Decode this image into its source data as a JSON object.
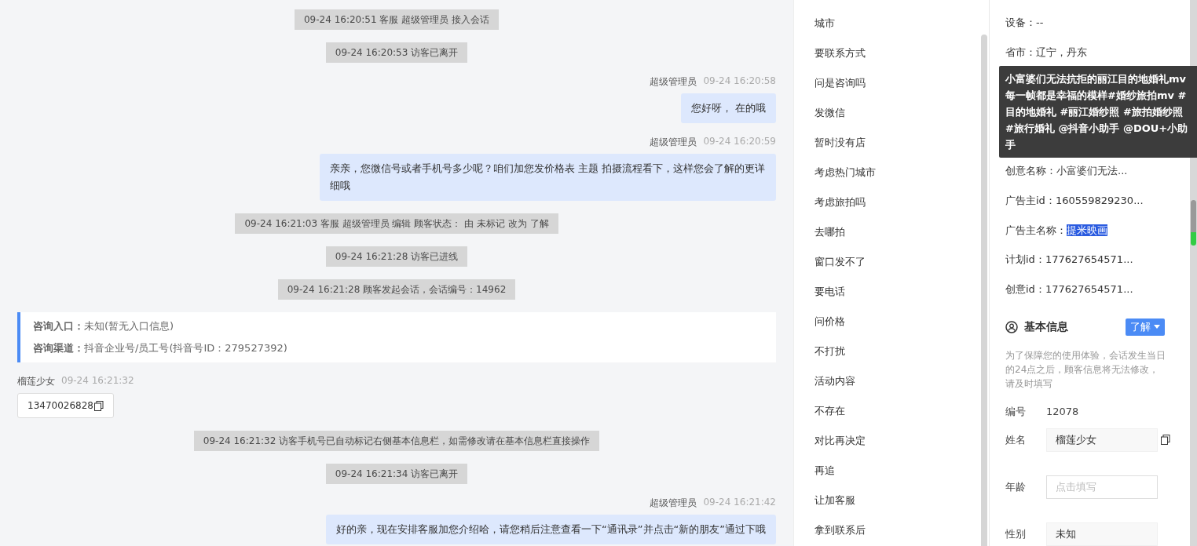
{
  "chat": [
    {
      "kind": "system",
      "text": "09-24 16:20:51 客服 超级管理员 接入会话"
    },
    {
      "kind": "system",
      "text": "09-24 16:20:53 访客已离开"
    },
    {
      "kind": "outgoing",
      "sender": "超级管理员",
      "time": "09-24 16:20:58",
      "text": "您好呀， 在的哦"
    },
    {
      "kind": "outgoing",
      "sender": "超级管理员",
      "time": "09-24 16:20:59",
      "text": "亲亲，您微信号或者手机号多少呢？咱们加您发价格表 主题 拍摄流程看下，这样您会了解的更详细哦"
    },
    {
      "kind": "system",
      "text": "09-24 16:21:03 客服 超级管理员 编辑 顾客状态： 由 未标记 改为 了解"
    },
    {
      "kind": "system",
      "text": "09-24 16:21:28 访客已进线"
    },
    {
      "kind": "system",
      "text": "09-24 16:21:28 顾客发起会话，会话编号：14962"
    },
    {
      "kind": "info_card",
      "lines": [
        {
          "label": "咨询入口：",
          "value": "未知(暂无入口信息)"
        },
        {
          "label": "咨询渠道：",
          "value": "抖音企业号/员工号(抖音号ID：279527392)"
        }
      ]
    },
    {
      "kind": "incoming_phone",
      "sender": "榴莲少女",
      "time": "09-24 16:21:32",
      "text": "13470026828"
    },
    {
      "kind": "system",
      "text": "09-24 16:21:32 访客手机号已自动标记右侧基本信息栏，如需修改请在基本信息栏直接操作"
    },
    {
      "kind": "system",
      "text": "09-24 16:21:34 访客已离开"
    },
    {
      "kind": "outgoing",
      "sender": "超级管理员",
      "time": "09-24 16:21:42",
      "text": "好的亲，现在安排客服加您介绍哈，请您稍后注意查看一下“通讯录”并点击“新的朋友”通过下哦"
    }
  ],
  "quick_replies": [
    "城市",
    "要联系方式",
    "问是咨询吗",
    "发微信",
    "暂时没有店",
    "考虑热门城市",
    "考虑旅拍吗",
    "去哪拍",
    "窗口发不了",
    "要电话",
    "问价格",
    "不打扰",
    "活动内容",
    "不存在",
    "对比再决定",
    "再追",
    "让加客服",
    "拿到联系后"
  ],
  "visitor_info": {
    "rows_top": [
      {
        "label": "设备：",
        "value": "--",
        "highlighted": false
      },
      {
        "label": "省市：",
        "value": "辽宁，丹东",
        "highlighted": false
      }
    ],
    "tooltip": "小富婆们无法抗拒的丽江目的地婚礼mv 每一帧都是幸福的模样#婚纱旅拍mv #目的地婚礼 #丽江婚纱照 #旅拍婚纱照 #旅行婚礼 @抖音小助手 @DOU+小助手",
    "rows": [
      {
        "label": "创意名称：",
        "value": "小富婆们无法...",
        "highlighted": false
      },
      {
        "label": "广告主id：",
        "value": "160559829230...",
        "highlighted": false
      },
      {
        "label": "广告主名称：",
        "value": "提米映画",
        "highlighted": true
      },
      {
        "label": "计划id：",
        "value": "177627654571...",
        "highlighted": false
      },
      {
        "label": "创意id：",
        "value": "177627654571...",
        "highlighted": false
      }
    ]
  },
  "basic_info": {
    "title": "基本信息",
    "status": "了解",
    "note": "为了保障您的使用体验，会话发生当日的24点之后，顾客信息将无法修改，请及时填写",
    "fields": [
      {
        "kind": "text",
        "label": "编号",
        "value": "12078"
      },
      {
        "kind": "input",
        "label": "姓名",
        "value": "榴莲少女",
        "copyable": true
      },
      {
        "kind": "input",
        "label": "年龄",
        "placeholder": "点击填写",
        "copyable": false
      },
      {
        "kind": "input",
        "label": "性别",
        "value": "未知",
        "copyable": false
      }
    ]
  }
}
